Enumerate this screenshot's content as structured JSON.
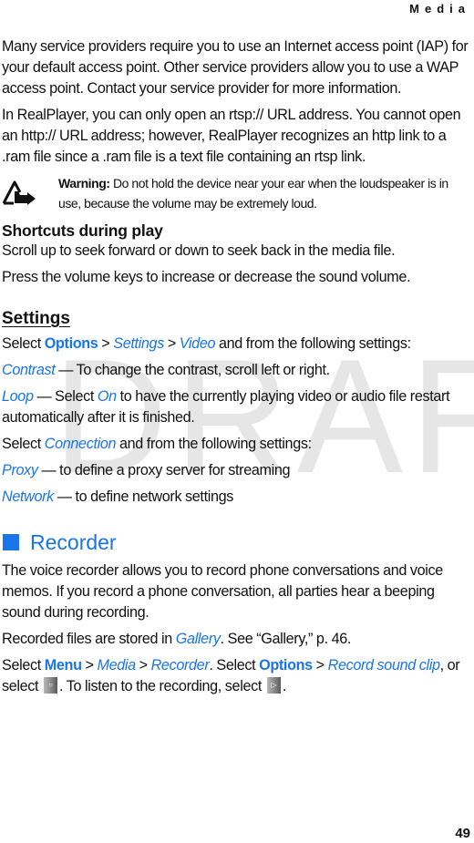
{
  "running_head": "Media",
  "page_number": "49",
  "watermark": "DRAFT",
  "colors": {
    "accent": "#1a75e8",
    "text": "#111111",
    "watermark": "#e6e6e6"
  },
  "intro": {
    "p1": "Many service providers require you to use an Internet access point (IAP) for your default access point. Other service providers allow you to use a WAP access point. Contact your service provider for more information.",
    "p2": "In RealPlayer, you can only open an rtsp:// URL address. You cannot open an http:// URL address; however, RealPlayer recognizes an http link to a .ram file since a .ram file is a text file containing an rtsp link."
  },
  "warning": {
    "icon": "warning-hand-icon",
    "label": "Warning:",
    "text": " Do not hold the device near your ear when the loudspeaker is in use, because the volume may be extremely loud."
  },
  "shortcuts": {
    "heading": "Shortcuts during play",
    "p1": "Scroll up to seek forward or down to seek back in the media file.",
    "p2": "Press the volume keys to increase or decrease the sound volume."
  },
  "settings": {
    "heading": "Settings",
    "line1": {
      "pre": "Select ",
      "options": "Options",
      "sep1": " > ",
      "settings": "Settings",
      "sep2": " > ",
      "video": "Video",
      "post": " and from the following settings:"
    },
    "contrast": {
      "term": "Contrast",
      "desc": " — To change the contrast, scroll left or right."
    },
    "loop": {
      "term": "Loop",
      "pre": " — Select ",
      "on": "On",
      "desc": " to have the currently playing video or audio file restart automatically after it is finished."
    },
    "connection": {
      "pre": "Select ",
      "term": "Connection",
      "post": " and from the following settings:"
    },
    "proxy": {
      "term": "Proxy",
      "desc": " — to define a proxy server for streaming"
    },
    "network": {
      "term": "Network",
      "desc": " — to define network settings"
    }
  },
  "recorder": {
    "heading": "Recorder",
    "p1": "The voice recorder allows you to record phone conversations and voice memos. If you record a phone conversation, all parties hear a beeping sound during recording.",
    "p2": {
      "pre": "Recorded files are stored in ",
      "gallery": "Gallery",
      "post": ". See “Gallery,” p. 46."
    },
    "p3": {
      "pre": "Select ",
      "menu": "Menu",
      "sep1": " > ",
      "media": "Media",
      "sep2": " > ",
      "recorder": "Recorder",
      "mid": ". Select ",
      "options": "Options",
      "sep3": " > ",
      "record": "Record sound clip",
      "mid2": ", or select ",
      "record_icon": "record-button-icon",
      "mid3": ". To listen to the recording, select ",
      "play_icon": "play-button-icon",
      "end": "."
    }
  }
}
